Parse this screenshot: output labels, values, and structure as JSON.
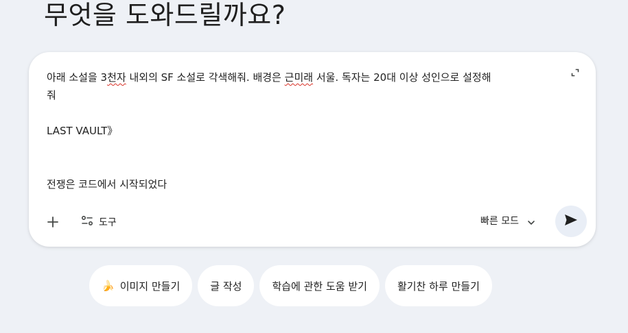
{
  "heading": "무엇을 도와드릴까요?",
  "composer": {
    "line1_a": "아래 소설을 3",
    "line1_spell1": "천자",
    "line1_b": " 내외의 SF 소설로 각색해줘. 배경은 ",
    "line1_spell2": "근미래",
    "line1_c": " 서울. 독자는 20대 이상 성인으로 설정해",
    "line2": "줘",
    "line3": "LAST VAULT》",
    "line4": "전쟁은 코드에서 시작되었다",
    "tools_label": "도구",
    "mode_label": "빠른 모드",
    "icons": {
      "expand": "expand-icon",
      "add": "plus-icon",
      "tools": "tools-icon",
      "mode": "chevron-down-icon",
      "send": "send-icon"
    }
  },
  "suggestions": [
    {
      "emoji": "🍌",
      "label": "이미지 만들기"
    },
    {
      "label": "글 작성"
    },
    {
      "label": "학습에 관한 도움 받기"
    },
    {
      "label": "활기찬 하루 만들기"
    }
  ],
  "colors": {
    "background": "#eef1f6",
    "card": "#ffffff",
    "send_button": "#e9eef6",
    "spellcheck": "#d93025"
  }
}
